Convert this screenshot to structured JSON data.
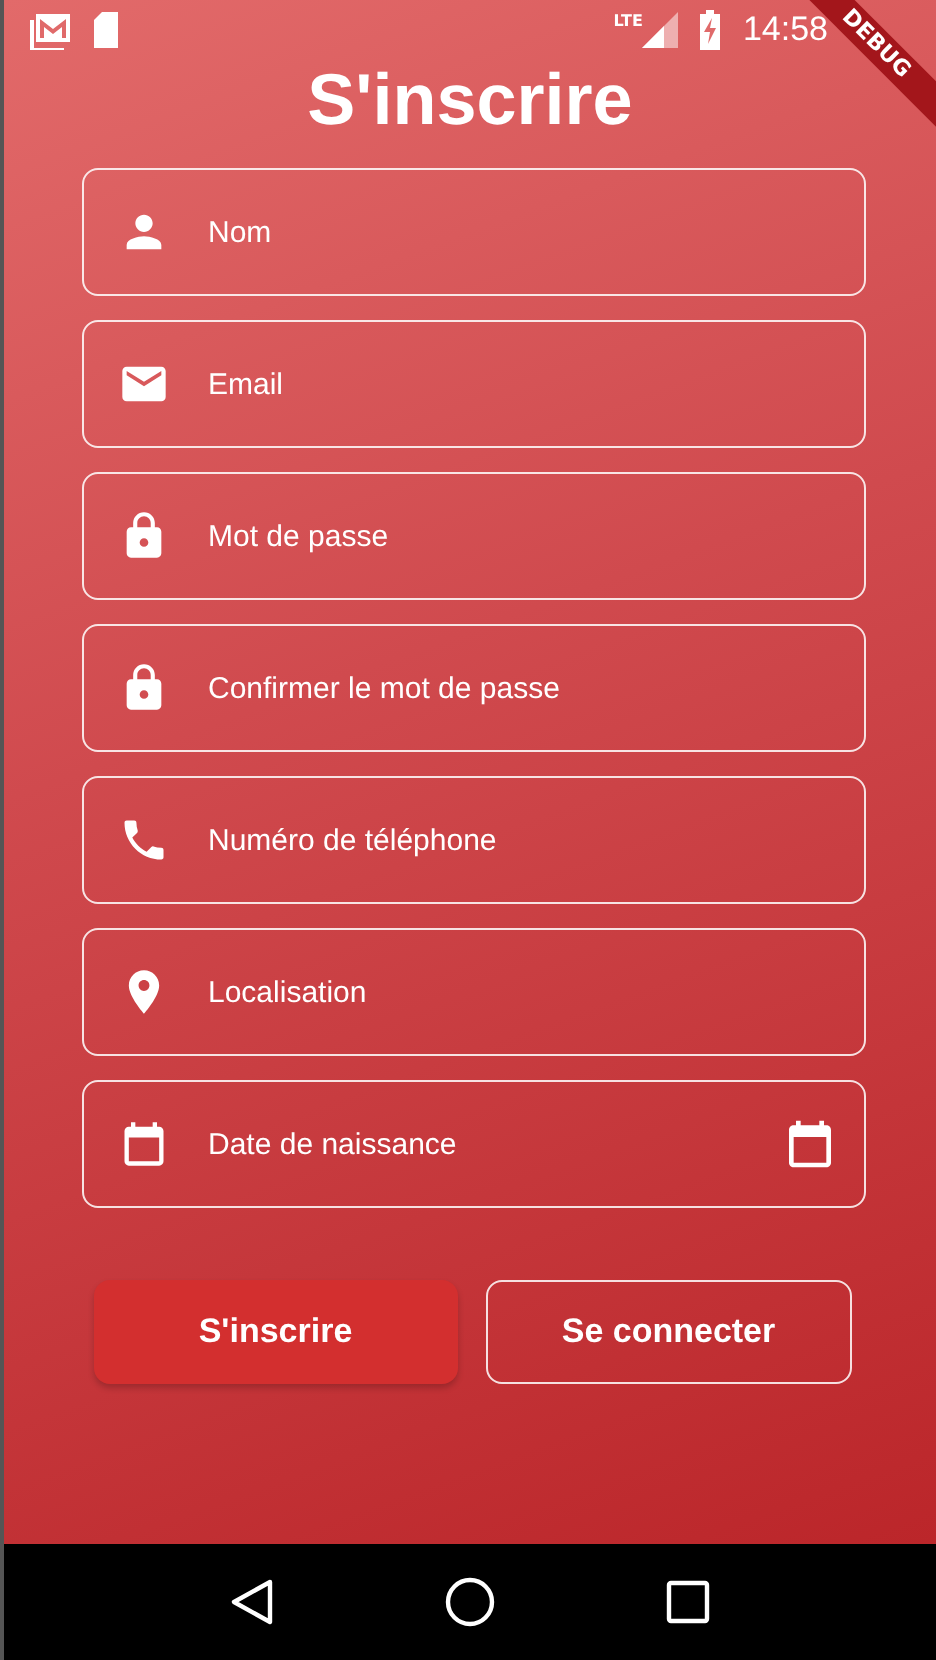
{
  "status_bar": {
    "time": "14:58",
    "network": "LTE"
  },
  "debug_banner": "DEBUG",
  "title": "S'inscrire",
  "fields": [
    {
      "kind": "name",
      "placeholder": "Nom"
    },
    {
      "kind": "email",
      "placeholder": "Email"
    },
    {
      "kind": "password",
      "placeholder": "Mot de passe"
    },
    {
      "kind": "password",
      "placeholder": "Confirmer le mot de passe"
    },
    {
      "kind": "phone",
      "placeholder": "Numéro de téléphone"
    },
    {
      "kind": "location",
      "placeholder": "Localisation"
    },
    {
      "kind": "date",
      "placeholder": "Date de naissance"
    }
  ],
  "buttons": [
    {
      "kind": "filled",
      "label": "S'inscrire"
    },
    {
      "kind": "outlined",
      "label": "Se connecter"
    }
  ]
}
